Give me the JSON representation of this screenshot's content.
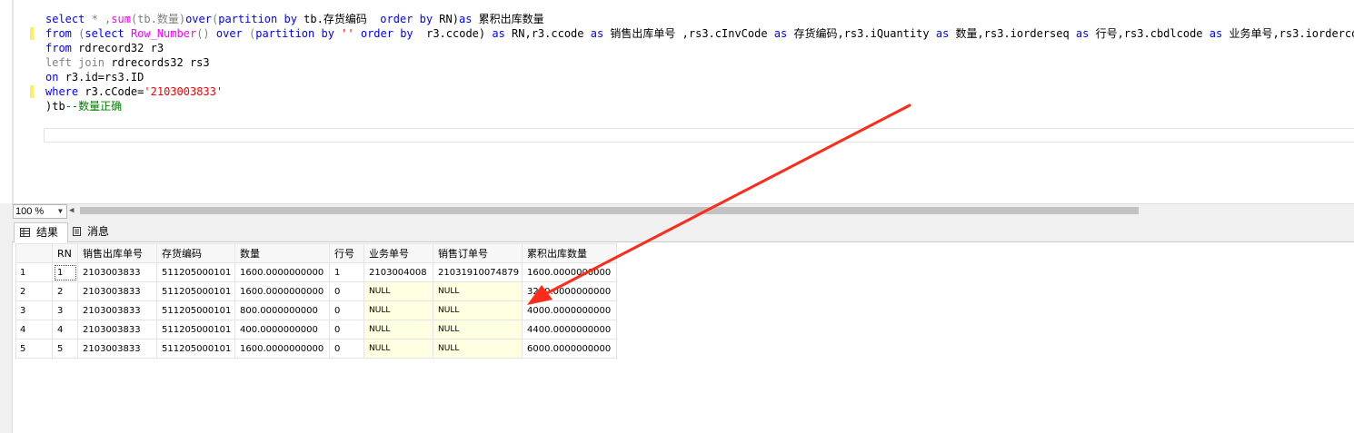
{
  "editor": {
    "lines": [
      {
        "marker": false,
        "tokens": [
          {
            "t": "select ",
            "c": "kw"
          },
          {
            "t": "* ",
            "c": "gr"
          },
          {
            "t": ",",
            "c": "gr"
          },
          {
            "t": "sum",
            "c": "fn"
          },
          {
            "t": "(tb.数量)",
            "c": "gr"
          },
          {
            "t": "over",
            "c": "kw"
          },
          {
            "t": "(",
            "c": "gr"
          },
          {
            "t": "partition by ",
            "c": "kw"
          },
          {
            "t": "tb.存货编码  ",
            "c": ""
          },
          {
            "t": "order by ",
            "c": "kw"
          },
          {
            "t": "RN)",
            "c": ""
          },
          {
            "t": "as ",
            "c": "kw"
          },
          {
            "t": "累积出库数量",
            "c": ""
          }
        ]
      },
      {
        "marker": true,
        "tokens": [
          {
            "t": "from ",
            "c": "kw"
          },
          {
            "t": "(",
            "c": "gr"
          },
          {
            "t": "select ",
            "c": "kw"
          },
          {
            "t": "Row_Number",
            "c": "fn"
          },
          {
            "t": "() ",
            "c": "gr"
          },
          {
            "t": "over ",
            "c": "kw"
          },
          {
            "t": "(",
            "c": "gr"
          },
          {
            "t": "partition by ",
            "c": "kw"
          },
          {
            "t": "'' ",
            "c": "str"
          },
          {
            "t": "order by  ",
            "c": "kw"
          },
          {
            "t": "r3.ccode) ",
            "c": ""
          },
          {
            "t": "as ",
            "c": "kw"
          },
          {
            "t": "RN,r3.ccode ",
            "c": ""
          },
          {
            "t": "as ",
            "c": "kw"
          },
          {
            "t": "销售出库单号 ,rs3.cInvCode ",
            "c": ""
          },
          {
            "t": "as ",
            "c": "kw"
          },
          {
            "t": "存货编码,rs3.iQuantity ",
            "c": ""
          },
          {
            "t": "as ",
            "c": "kw"
          },
          {
            "t": "数量,rs3.iorderseq ",
            "c": ""
          },
          {
            "t": "as ",
            "c": "kw"
          },
          {
            "t": "行号,rs3.cbdlcode ",
            "c": ""
          },
          {
            "t": "as ",
            "c": "kw"
          },
          {
            "t": "业务单号,rs3.iorderco",
            "c": ""
          }
        ]
      },
      {
        "marker": false,
        "tokens": [
          {
            "t": "from ",
            "c": "kw"
          },
          {
            "t": "rdrecord32 r3",
            "c": ""
          }
        ]
      },
      {
        "marker": false,
        "tokens": [
          {
            "t": "left join ",
            "c": "gr"
          },
          {
            "t": "rdrecords32 rs3",
            "c": ""
          }
        ]
      },
      {
        "marker": false,
        "tokens": [
          {
            "t": "on ",
            "c": "kw"
          },
          {
            "t": "r3.id=rs3.ID",
            "c": ""
          }
        ]
      },
      {
        "marker": true,
        "tokens": [
          {
            "t": "where ",
            "c": "kw"
          },
          {
            "t": "r3.cCode=",
            "c": ""
          },
          {
            "t": "'2103003833'",
            "c": "str"
          }
        ]
      },
      {
        "marker": false,
        "tokens": [
          {
            "t": ")tb",
            "c": ""
          },
          {
            "t": "--数量正确",
            "c": "cmt"
          }
        ]
      }
    ]
  },
  "statusbar": {
    "zoom": "100 %"
  },
  "tabs": [
    {
      "label": "结果",
      "icon": "grid-icon"
    },
    {
      "label": "消息",
      "icon": "message-icon"
    }
  ],
  "grid": {
    "columns": [
      "",
      "RN",
      "销售出库单号",
      "存货编码",
      "数量",
      "行号",
      "业务单号",
      "销售订单号",
      "累积出库数量"
    ],
    "rows": [
      [
        "1",
        "1",
        "2103003833",
        "511205000101",
        "1600.0000000000",
        "1",
        "2103004008",
        "21031910074879",
        "1600.0000000000"
      ],
      [
        "2",
        "2",
        "2103003833",
        "511205000101",
        "1600.0000000000",
        "0",
        "NULL",
        "NULL",
        "3200.0000000000"
      ],
      [
        "3",
        "3",
        "2103003833",
        "511205000101",
        "800.0000000000",
        "0",
        "NULL",
        "NULL",
        "4000.0000000000"
      ],
      [
        "4",
        "4",
        "2103003833",
        "511205000101",
        "400.0000000000",
        "0",
        "NULL",
        "NULL",
        "4400.0000000000"
      ],
      [
        "5",
        "5",
        "2103003833",
        "511205000101",
        "1600.0000000000",
        "0",
        "NULL",
        "NULL",
        "6000.0000000000"
      ]
    ]
  },
  "annotation": {
    "color": "#ff2a1a"
  }
}
